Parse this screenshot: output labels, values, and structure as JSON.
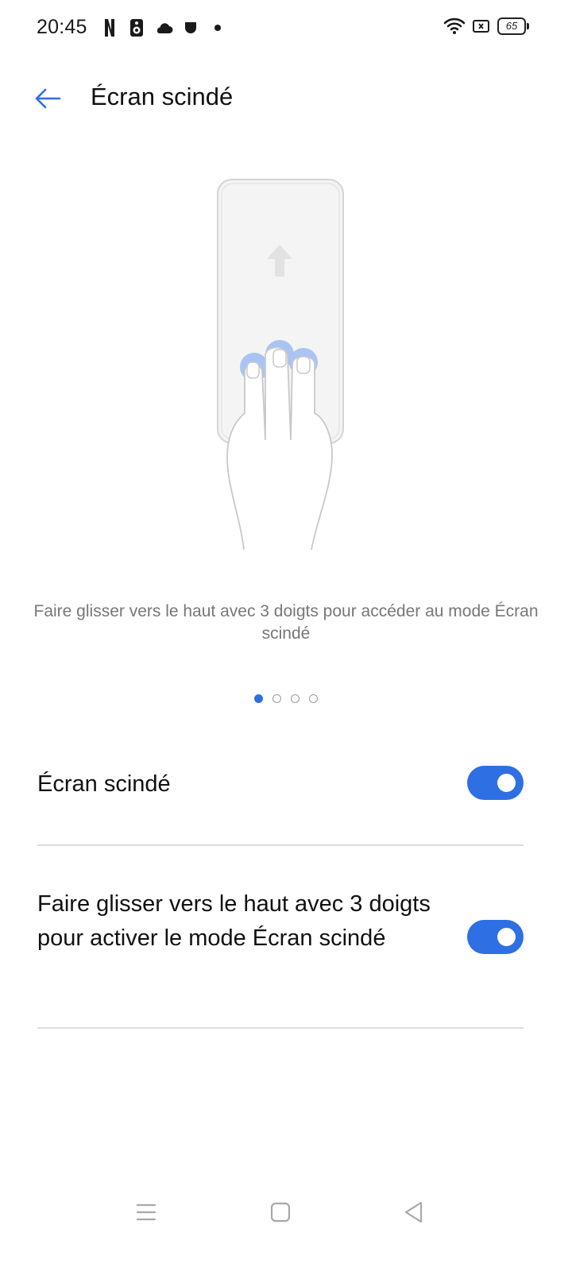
{
  "status_bar": {
    "time": "20:45",
    "left_icons": [
      "netflix-icon",
      "speaker-icon",
      "cloud-icon",
      "pocket-icon",
      "dot-icon"
    ],
    "right_icons": [
      "wifi-icon",
      "nosim-icon",
      "battery-icon"
    ],
    "battery_level": "65"
  },
  "header": {
    "back_icon": "arrow-left-icon",
    "title": "Écran scindé"
  },
  "illustration": {
    "icon": "three-finger-swipe-up-icon"
  },
  "caption": "Faire glisser vers le haut avec 3 doigts pour accéder au mode Écran scindé",
  "pager": {
    "total": 4,
    "active_index": 0
  },
  "settings": [
    {
      "label": "Écran scindé",
      "enabled": true
    },
    {
      "label": "Faire glisser vers le haut avec 3 doigts pour activer le mode Écran scindé",
      "enabled": true
    }
  ],
  "colors": {
    "accent": "#2f6fe4",
    "caption": "#777777",
    "divider": "#dedede"
  },
  "nav_bar": {
    "buttons": [
      "menu-icon",
      "home-icon",
      "back-triangle-icon"
    ]
  }
}
